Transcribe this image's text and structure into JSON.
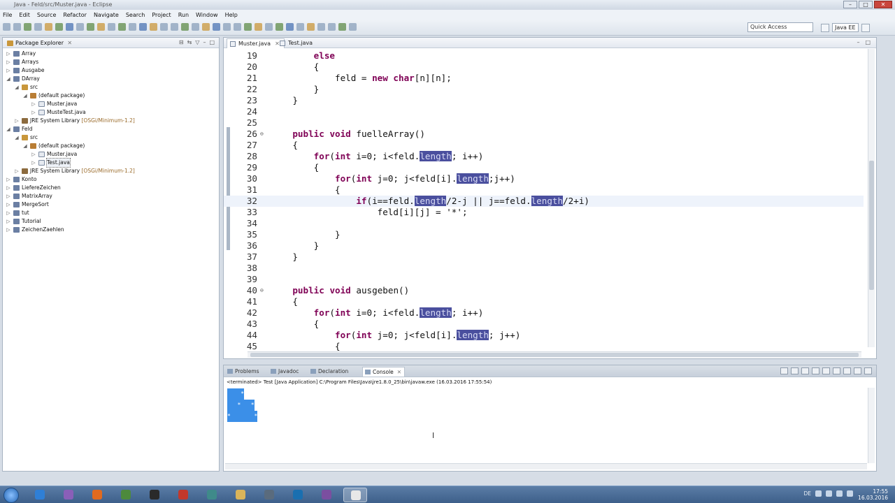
{
  "window": {
    "title": "Java - Feld/src/Muster.java - Eclipse"
  },
  "menu": [
    "File",
    "Edit",
    "Source",
    "Refactor",
    "Navigate",
    "Search",
    "Project",
    "Run",
    "Window",
    "Help"
  ],
  "toolbar": {
    "quick_access": "Quick Access",
    "perspective": "Java EE"
  },
  "package_explorer": {
    "title": "Package Explorer",
    "tree": [
      {
        "label": "Array",
        "type": "project",
        "depth": 0,
        "twisty": "▷"
      },
      {
        "label": "Arrays",
        "type": "project",
        "depth": 0,
        "twisty": "▷"
      },
      {
        "label": "Ausgabe",
        "type": "project",
        "depth": 0,
        "twisty": "▷"
      },
      {
        "label": "DArray",
        "type": "project",
        "depth": 0,
        "twisty": "◢"
      },
      {
        "label": "src",
        "type": "src",
        "depth": 1,
        "twisty": "◢"
      },
      {
        "label": "(default package)",
        "type": "pkg",
        "depth": 2,
        "twisty": "◢"
      },
      {
        "label": "Muster.java",
        "type": "java",
        "depth": 3,
        "twisty": "▷"
      },
      {
        "label": "MusteTest.java",
        "type": "java",
        "depth": 3,
        "twisty": "▷"
      },
      {
        "label": "JRE System Library",
        "dec": " [OSGi/Minimum-1.2]",
        "type": "lib",
        "depth": 1,
        "twisty": "▷"
      },
      {
        "label": "Feld",
        "type": "project",
        "depth": 0,
        "twisty": "◢"
      },
      {
        "label": "src",
        "type": "src",
        "depth": 1,
        "twisty": "◢"
      },
      {
        "label": "(default package)",
        "type": "pkg",
        "depth": 2,
        "twisty": "◢"
      },
      {
        "label": "Muster.java",
        "type": "java",
        "depth": 3,
        "twisty": "▷"
      },
      {
        "label": "Test.java",
        "type": "java",
        "depth": 3,
        "twisty": "▷",
        "selected": true
      },
      {
        "label": "JRE System Library",
        "dec": " [OSGi/Minimum-1.2]",
        "type": "lib",
        "depth": 1,
        "twisty": "▷"
      },
      {
        "label": "Konto",
        "type": "project",
        "depth": 0,
        "twisty": "▷"
      },
      {
        "label": "LiefereZeichen",
        "type": "project",
        "depth": 0,
        "twisty": "▷"
      },
      {
        "label": "MatrixArray",
        "type": "project",
        "depth": 0,
        "twisty": "▷"
      },
      {
        "label": "MergeSort",
        "type": "project",
        "depth": 0,
        "twisty": "▷"
      },
      {
        "label": "tut",
        "type": "project",
        "depth": 0,
        "twisty": "▷"
      },
      {
        "label": "Tutorial",
        "type": "project",
        "depth": 0,
        "twisty": "▷"
      },
      {
        "label": "ZeichenZaehlen",
        "type": "project",
        "depth": 0,
        "twisty": "▷"
      }
    ]
  },
  "editor": {
    "tabs": [
      {
        "label": "Muster.java",
        "active": true
      },
      {
        "label": "Test.java",
        "active": false
      }
    ],
    "current_line": 32,
    "lines": [
      {
        "n": "19",
        "code": [
          [
            "        ",
            ""
          ],
          [
            "else",
            "kw"
          ]
        ]
      },
      {
        "n": "20",
        "code": [
          [
            "        {",
            ""
          ]
        ]
      },
      {
        "n": "21",
        "code": [
          [
            "            feld = ",
            ""
          ],
          [
            "new",
            "kw"
          ],
          [
            " ",
            ""
          ],
          [
            "char",
            "kw"
          ],
          [
            "[n][n];",
            ""
          ]
        ]
      },
      {
        "n": "22",
        "code": [
          [
            "        }",
            ""
          ]
        ]
      },
      {
        "n": "23",
        "code": [
          [
            "    }",
            ""
          ]
        ]
      },
      {
        "n": "24",
        "code": [
          [
            "",
            ""
          ]
        ]
      },
      {
        "n": "25",
        "code": [
          [
            "",
            ""
          ]
        ]
      },
      {
        "n": "26",
        "fold": "⊖",
        "code": [
          [
            "    ",
            ""
          ],
          [
            "public",
            "kw"
          ],
          [
            " ",
            ""
          ],
          [
            "void",
            "kw"
          ],
          [
            " fuelleArray()",
            ""
          ]
        ]
      },
      {
        "n": "27",
        "code": [
          [
            "    {",
            ""
          ]
        ]
      },
      {
        "n": "28",
        "code": [
          [
            "        ",
            ""
          ],
          [
            "for",
            "kw"
          ],
          [
            "(",
            ""
          ],
          [
            "int",
            "kw"
          ],
          [
            " i=0; i<feld.",
            ""
          ],
          [
            "length",
            "hl"
          ],
          [
            "; i++)",
            ""
          ]
        ]
      },
      {
        "n": "29",
        "code": [
          [
            "        {",
            ""
          ]
        ]
      },
      {
        "n": "30",
        "code": [
          [
            "            ",
            ""
          ],
          [
            "for",
            "kw"
          ],
          [
            "(",
            ""
          ],
          [
            "int",
            "kw"
          ],
          [
            " j=0; j<feld[i].",
            ""
          ],
          [
            "length",
            "hl"
          ],
          [
            ";j++)",
            ""
          ]
        ]
      },
      {
        "n": "31",
        "code": [
          [
            "            {",
            ""
          ]
        ]
      },
      {
        "n": "32",
        "code": [
          [
            "                ",
            ""
          ],
          [
            "if",
            "kw"
          ],
          [
            "(i==feld.",
            ""
          ],
          [
            "length",
            "hl"
          ],
          [
            "/2-j || j==feld.",
            ""
          ],
          [
            "length",
            "hl"
          ],
          [
            "/2+i)",
            ""
          ]
        ]
      },
      {
        "n": "33",
        "code": [
          [
            "                    feld[i][j] = '*';",
            ""
          ]
        ]
      },
      {
        "n": "34",
        "code": [
          [
            "",
            ""
          ]
        ]
      },
      {
        "n": "35",
        "code": [
          [
            "            }",
            ""
          ]
        ]
      },
      {
        "n": "36",
        "code": [
          [
            "        }",
            ""
          ]
        ]
      },
      {
        "n": "37",
        "code": [
          [
            "    }",
            ""
          ]
        ]
      },
      {
        "n": "38",
        "code": [
          [
            "",
            ""
          ]
        ]
      },
      {
        "n": "39",
        "code": [
          [
            "",
            ""
          ]
        ]
      },
      {
        "n": "40",
        "fold": "⊖",
        "code": [
          [
            "    ",
            ""
          ],
          [
            "public",
            "kw"
          ],
          [
            " ",
            ""
          ],
          [
            "void",
            "kw"
          ],
          [
            " ausgeben()",
            ""
          ]
        ]
      },
      {
        "n": "41",
        "code": [
          [
            "    {",
            ""
          ]
        ]
      },
      {
        "n": "42",
        "code": [
          [
            "        ",
            ""
          ],
          [
            "for",
            "kw"
          ],
          [
            "(",
            ""
          ],
          [
            "int",
            "kw"
          ],
          [
            " i=0; i<feld.",
            ""
          ],
          [
            "length",
            "hl"
          ],
          [
            "; i++)",
            ""
          ]
        ]
      },
      {
        "n": "43",
        "code": [
          [
            "        {",
            ""
          ]
        ]
      },
      {
        "n": "44",
        "code": [
          [
            "            ",
            ""
          ],
          [
            "for",
            "kw"
          ],
          [
            "(",
            ""
          ],
          [
            "int",
            "kw"
          ],
          [
            " j=0; j<feld[i].",
            ""
          ],
          [
            "length",
            "hl"
          ],
          [
            "; j++)",
            ""
          ]
        ]
      },
      {
        "n": "45",
        "code": [
          [
            "            {",
            ""
          ]
        ]
      }
    ]
  },
  "bottom_panel": {
    "tabs": [
      {
        "label": "Problems",
        "active": false
      },
      {
        "label": "Javadoc",
        "active": false
      },
      {
        "label": "Declaration",
        "active": false
      },
      {
        "label": "Console",
        "active": true
      }
    ],
    "console_status": "<terminated> Test [Java Application] C:\\Program Files\\Java\\jre1.8.0_25\\bin\\javaw.exe (16.03.2016 17:55:54)",
    "output": [
      "    *",
      "   *   *",
      "*       *"
    ]
  },
  "taskbar": {
    "tray_lang": "DE",
    "time": "17:55",
    "date": "16.03.2016"
  }
}
